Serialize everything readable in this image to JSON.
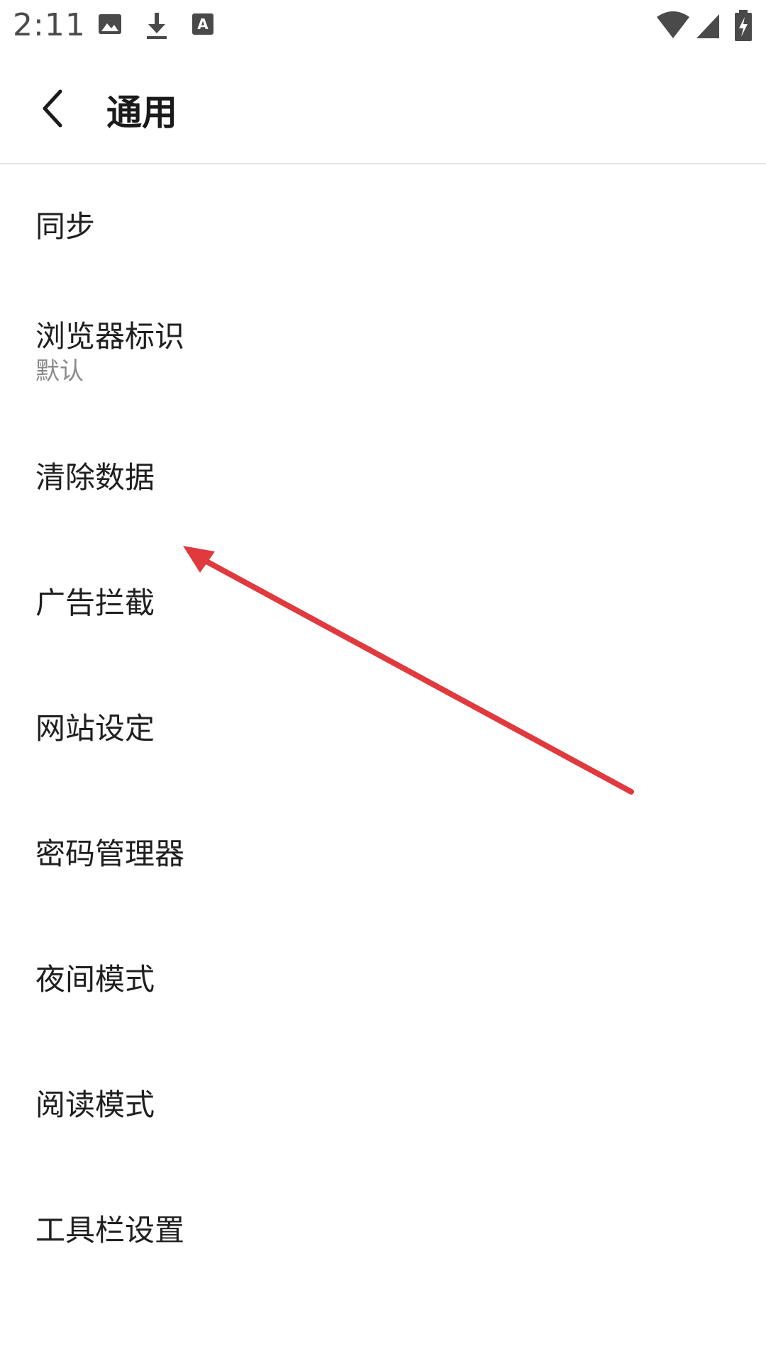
{
  "status_bar": {
    "time": "2:11",
    "left_icons": [
      "image-icon",
      "download-icon",
      "font-a-icon"
    ],
    "right_icons": [
      "wifi-icon",
      "cellular-signal-icon",
      "battery-charging-icon"
    ]
  },
  "header": {
    "title": "通用",
    "back_icon": "chevron-left-icon"
  },
  "settings": {
    "items": [
      {
        "label": "同步"
      },
      {
        "label": "浏览器标识",
        "sublabel": "默认"
      },
      {
        "label": "清除数据"
      },
      {
        "label": "广告拦截"
      },
      {
        "label": "网站设定"
      },
      {
        "label": "密码管理器"
      },
      {
        "label": "夜间模式"
      },
      {
        "label": "阅读模式"
      },
      {
        "label": "工具栏设置"
      }
    ]
  },
  "colors": {
    "background": "#ffffff",
    "text_primary": "#1f1f1f",
    "text_secondary": "#8a8a8a",
    "divider": "#e4e4e4",
    "annotation_arrow": "#e0393e"
  }
}
